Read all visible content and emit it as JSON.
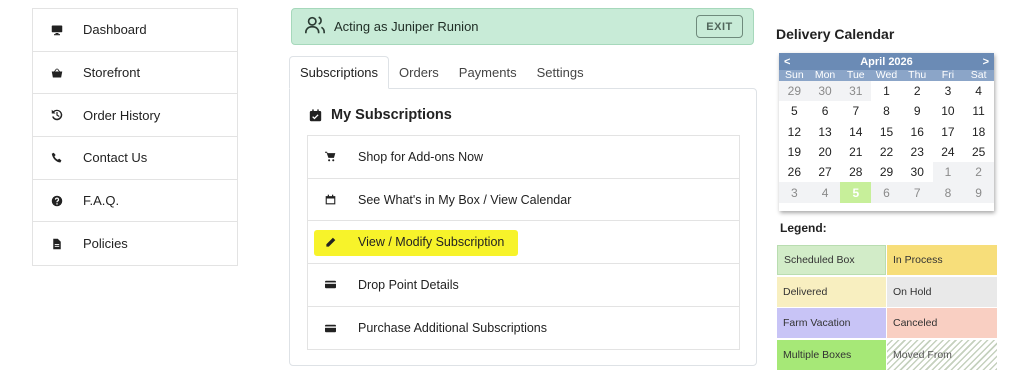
{
  "sidebar": {
    "items": [
      {
        "label": "Dashboard",
        "icon": "monitor-icon"
      },
      {
        "label": "Storefront",
        "icon": "basket-icon"
      },
      {
        "label": "Order History",
        "icon": "history-icon"
      },
      {
        "label": "Contact Us",
        "icon": "phone-icon"
      },
      {
        "label": "F.A.Q.",
        "icon": "question-icon"
      },
      {
        "label": "Policies",
        "icon": "document-icon"
      }
    ]
  },
  "banner": {
    "text": "Acting as Juniper Runion",
    "exit_label": "EXIT",
    "icon": "users-icon"
  },
  "tabs": [
    {
      "label": "Subscriptions",
      "active": true
    },
    {
      "label": "Orders",
      "active": false
    },
    {
      "label": "Payments",
      "active": false
    },
    {
      "label": "Settings",
      "active": false
    }
  ],
  "subscriptions": {
    "title": "My Subscriptions",
    "title_icon": "calendar-check-icon",
    "items": [
      {
        "label": "Shop for Add-ons Now",
        "icon": "cart-icon"
      },
      {
        "label": "See What's in My Box / View Calendar",
        "icon": "calendar-icon"
      },
      {
        "label": "View / Modify Subscription",
        "icon": "pencil-icon",
        "highlighted": true
      },
      {
        "label": "Drop Point Details",
        "icon": "card-icon"
      },
      {
        "label": "Purchase Additional Subscriptions",
        "icon": "card-icon"
      }
    ]
  },
  "calendar": {
    "heading": "Delivery Calendar",
    "month_label": "April 2026",
    "prev_label": "<",
    "next_label": ">",
    "dow": [
      "Sun",
      "Mon",
      "Tue",
      "Wed",
      "Thu",
      "Fri",
      "Sat"
    ],
    "weeks": [
      [
        {
          "d": "29",
          "other": true
        },
        {
          "d": "30",
          "other": true
        },
        {
          "d": "31",
          "other": true
        },
        {
          "d": "1"
        },
        {
          "d": "2"
        },
        {
          "d": "3"
        },
        {
          "d": "4"
        }
      ],
      [
        {
          "d": "5"
        },
        {
          "d": "6"
        },
        {
          "d": "7"
        },
        {
          "d": "8"
        },
        {
          "d": "9"
        },
        {
          "d": "10"
        },
        {
          "d": "11"
        }
      ],
      [
        {
          "d": "12"
        },
        {
          "d": "13"
        },
        {
          "d": "14"
        },
        {
          "d": "15"
        },
        {
          "d": "16"
        },
        {
          "d": "17"
        },
        {
          "d": "18"
        }
      ],
      [
        {
          "d": "19"
        },
        {
          "d": "20"
        },
        {
          "d": "21"
        },
        {
          "d": "22"
        },
        {
          "d": "23"
        },
        {
          "d": "24"
        },
        {
          "d": "25"
        }
      ],
      [
        {
          "d": "26"
        },
        {
          "d": "27"
        },
        {
          "d": "28"
        },
        {
          "d": "29"
        },
        {
          "d": "30"
        },
        {
          "d": "1",
          "other": true
        },
        {
          "d": "2",
          "other": true
        }
      ],
      [
        {
          "d": "3",
          "other": true
        },
        {
          "d": "4",
          "other": true
        },
        {
          "d": "5",
          "other": true,
          "today": true
        },
        {
          "d": "6",
          "other": true
        },
        {
          "d": "7",
          "other": true
        },
        {
          "d": "8",
          "other": true
        },
        {
          "d": "9",
          "other": true
        }
      ]
    ]
  },
  "legend": {
    "title": "Legend:",
    "items": [
      {
        "label": "Scheduled Box",
        "color": "#d2ecc8"
      },
      {
        "label": "In Process",
        "color": "#f7de7a"
      },
      {
        "label": "Delivered",
        "color": "#f8efc0"
      },
      {
        "label": "On Hold",
        "color": "#e9e9e9"
      },
      {
        "label": "Farm Vacation",
        "color": "#c8c4f6"
      },
      {
        "label": "Canceled",
        "color": "#f9cfc2"
      },
      {
        "label": "Multiple Boxes",
        "color": "#a6e877"
      },
      {
        "label": "Moved From",
        "color": "striped"
      }
    ]
  },
  "colors": {
    "banner_bg": "#c8ebd7",
    "calendar_header": "#6b8bb5",
    "highlight": "#f7f32a"
  }
}
